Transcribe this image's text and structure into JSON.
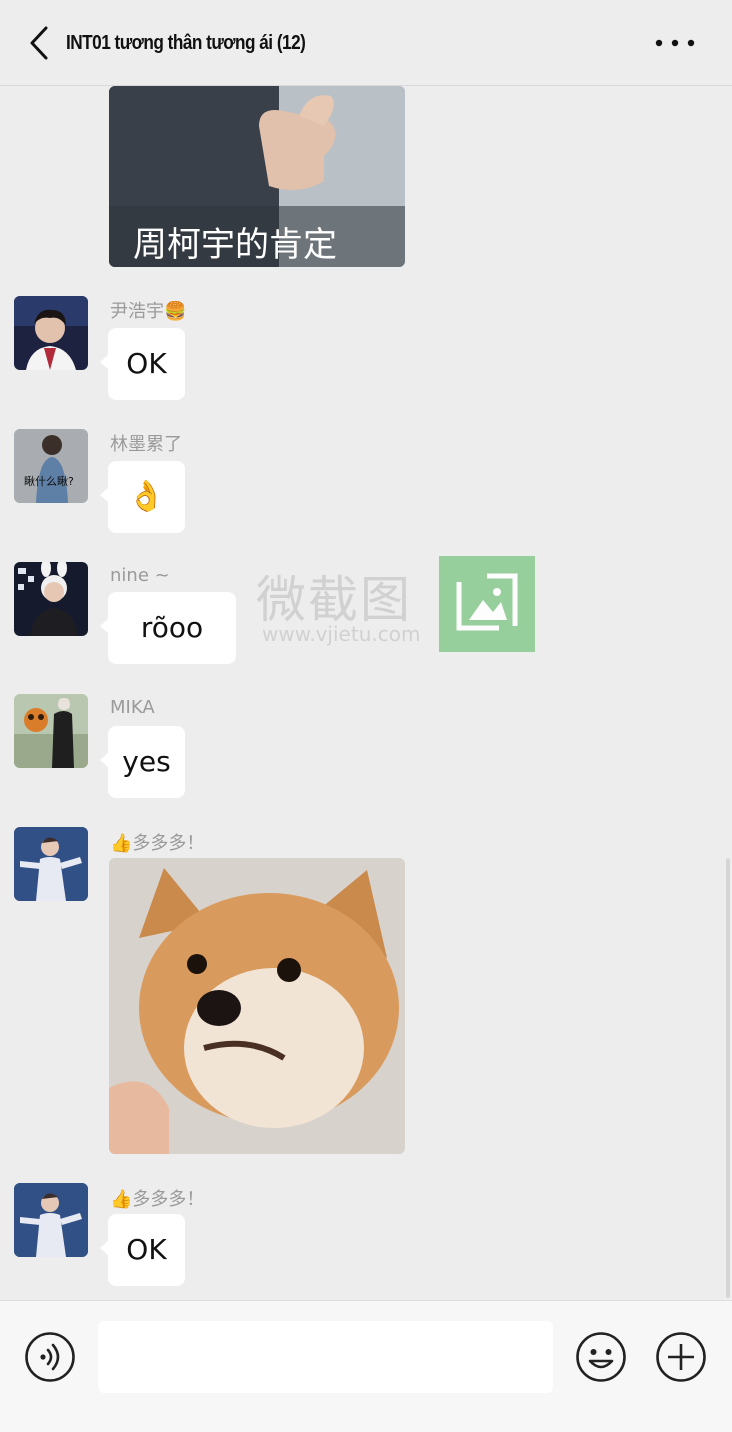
{
  "header": {
    "title": "INT01 tương thân tương ái (12)",
    "back_icon": "chevron-left-icon",
    "more_icon": "more-dots-icon"
  },
  "messages": [
    {
      "type": "image",
      "caption": "周柯宇的肯定",
      "subject": "thumbs-up sticker"
    },
    {
      "type": "text",
      "sender": "尹浩宇🍔",
      "text": "OK"
    },
    {
      "type": "text",
      "sender": "林墨累了",
      "avatar_caption": "瞅什么瞅?",
      "text": "👌"
    },
    {
      "type": "text",
      "sender": "nine ~",
      "text": "rõoo"
    },
    {
      "type": "text",
      "sender": "MIKA",
      "text": "yes"
    },
    {
      "type": "image",
      "sender": "👍多多多！",
      "subject": "shiba inu puppy photo"
    },
    {
      "type": "text",
      "sender": "👍多多多！",
      "text": "OK"
    }
  ],
  "watermark": {
    "text": "微截图",
    "url": "www.vjietu.com"
  },
  "input_bar": {
    "voice_icon": "voice-icon",
    "message_value": "",
    "emoji_icon": "emoji-icon",
    "plus_icon": "plus-icon"
  },
  "colors": {
    "background": "#ededed",
    "bubble": "#ffffff",
    "sender_text": "#9a9a9a",
    "watermark_logo": "#8dcc94"
  }
}
